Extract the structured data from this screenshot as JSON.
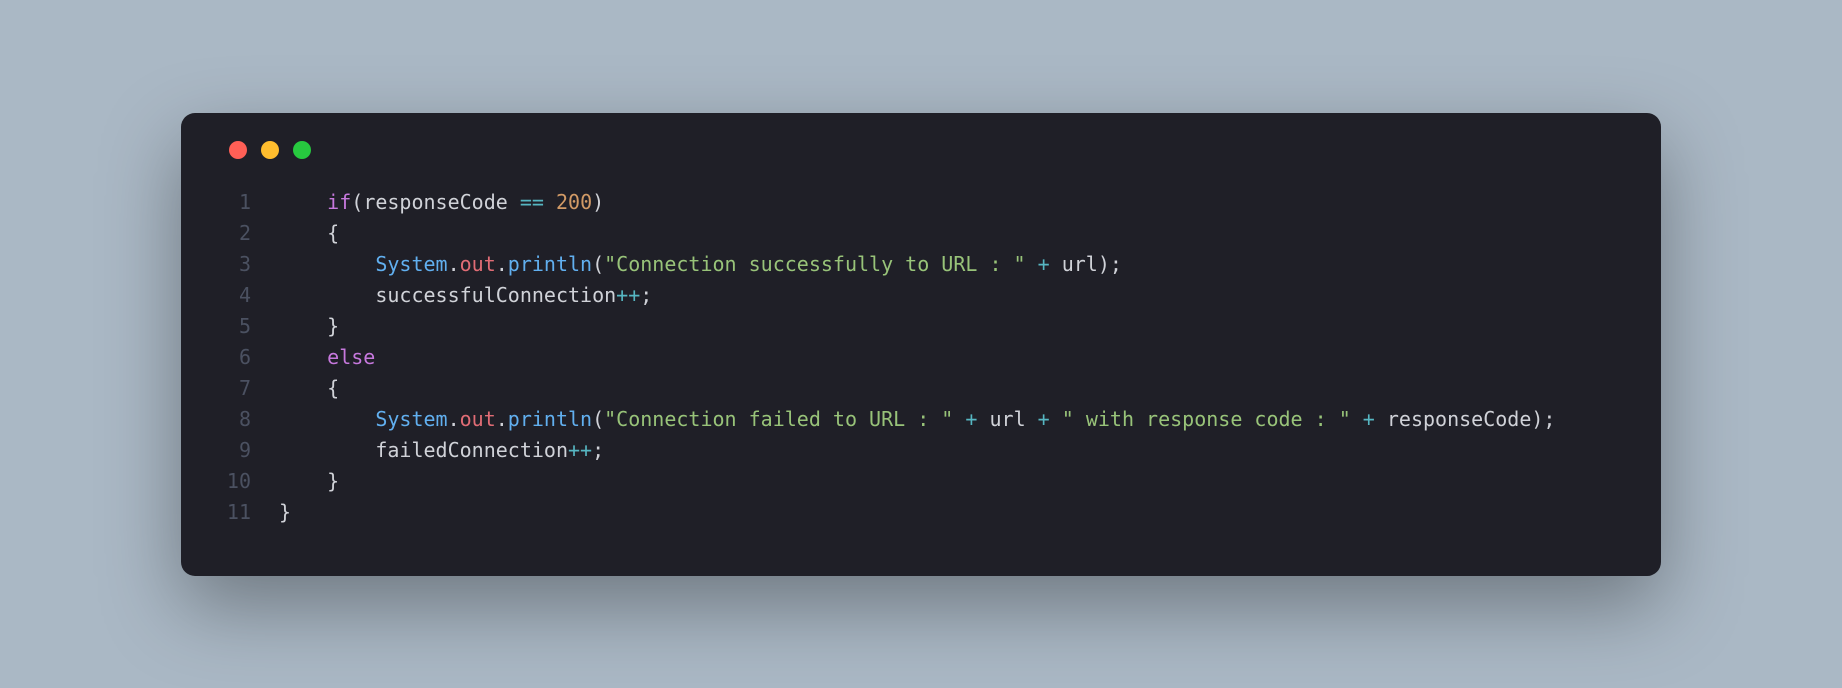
{
  "window": {
    "traffic_lights": {
      "red": "#ff5f56",
      "yellow": "#ffbd2e",
      "green": "#27c93f"
    }
  },
  "gutter": [
    "1",
    "2",
    "3",
    "4",
    "5",
    "6",
    "7",
    "8",
    "9",
    "10",
    "11"
  ],
  "code": {
    "l1": {
      "indent": "    ",
      "if": "if",
      "lp": "(",
      "var": "responseCode",
      "sp1": " ",
      "eq": "==",
      "sp2": " ",
      "num": "200",
      "rp": ")"
    },
    "l2": {
      "indent": "    ",
      "brace": "{"
    },
    "l3": {
      "indent": "        ",
      "cls": "System",
      "d1": ".",
      "out": "out",
      "d2": ".",
      "fn": "println",
      "lp": "(",
      "str": "\"Connection successfully to URL : \"",
      "sp1": " ",
      "plus": "+",
      "sp2": " ",
      "var": "url",
      "rp": ")",
      "sc": ";"
    },
    "l4": {
      "indent": "        ",
      "var": "successfulConnection",
      "inc": "++",
      "sc": ";"
    },
    "l5": {
      "indent": "    ",
      "brace": "}"
    },
    "l6": {
      "indent": "    ",
      "else": "else"
    },
    "l7": {
      "indent": "    ",
      "brace": "{"
    },
    "l8": {
      "indent": "        ",
      "cls": "System",
      "d1": ".",
      "out": "out",
      "d2": ".",
      "fn": "println",
      "lp": "(",
      "str1": "\"Connection failed to URL : \"",
      "sp1": " ",
      "p1": "+",
      "sp2": " ",
      "var1": "url",
      "sp3": " ",
      "p2": "+",
      "sp4": " ",
      "str2": "\" with response code : \"",
      "sp5": " ",
      "p3": "+",
      "sp6": " ",
      "var2": "responseCode",
      "rp": ")",
      "sc": ";"
    },
    "l9": {
      "indent": "        ",
      "var": "failedConnection",
      "inc": "++",
      "sc": ";"
    },
    "l10": {
      "indent": "    ",
      "brace": "}"
    },
    "l11": {
      "indent": "",
      "brace": "}"
    }
  }
}
